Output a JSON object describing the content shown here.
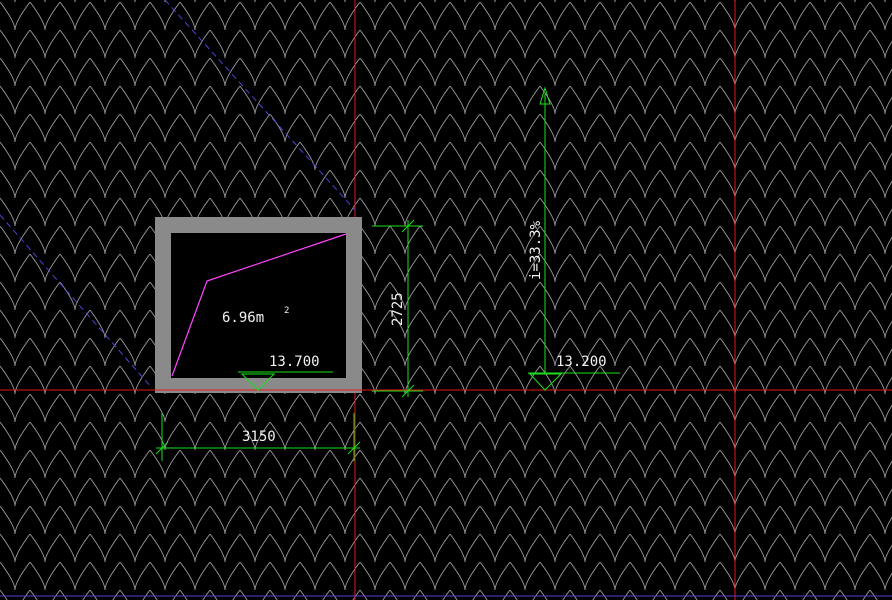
{
  "colors": {
    "background": "#000000",
    "tile_pattern": "#cfcfcf",
    "axis_red": "#e0191b",
    "dashed_purple": "#5b3bd6",
    "dimension_green": "#19e01a",
    "wall_gray": "#8a8a8a",
    "outline_pink": "#ff44ff",
    "text_white": "#f2f2f2"
  },
  "room": {
    "area_value": "6.96m",
    "area_superscript": "2",
    "elevation_label": "13.700"
  },
  "dimensions": {
    "width_label": "3150",
    "height_label": "2725"
  },
  "slope": {
    "label": "i=33.3%",
    "elevation_label": "13.200"
  },
  "icons": {
    "elevation_marker": "elevation-triangle-icon",
    "slope_arrow": "slope-arrow-icon"
  }
}
